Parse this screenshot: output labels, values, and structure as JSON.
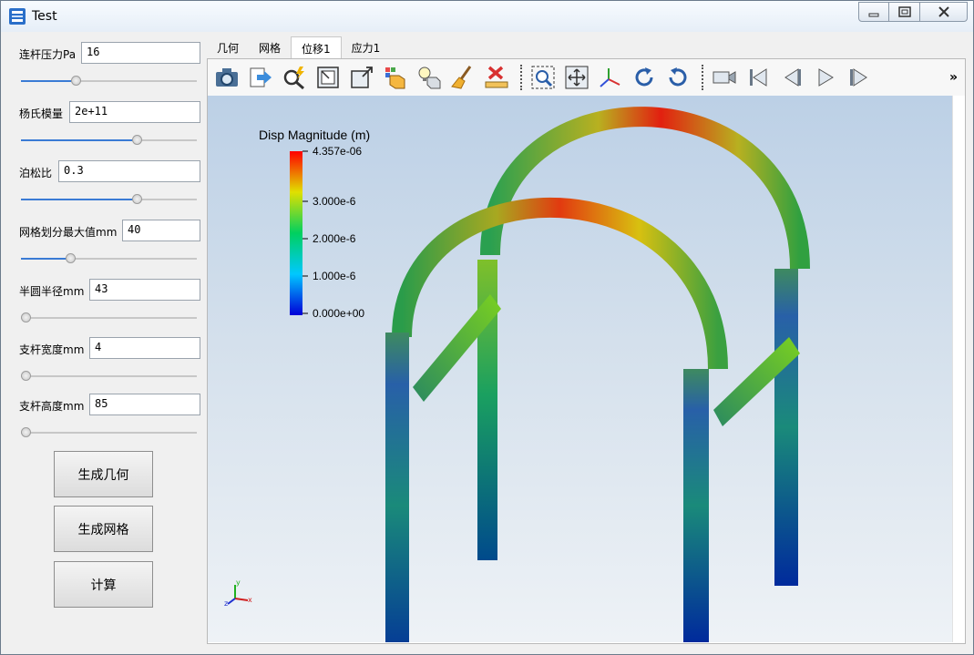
{
  "window": {
    "title": "Test"
  },
  "params": [
    {
      "label": "连杆压力Pa",
      "value": "16",
      "slider": 0.3
    },
    {
      "label": "杨氏模量",
      "value": "2e+11",
      "slider": 0.67
    },
    {
      "label": "泊松比",
      "value": "0.3",
      "slider": 0.67
    },
    {
      "label": "网格划分最大值mm",
      "value": "40",
      "slider": 0.27
    },
    {
      "label": "半圆半径mm",
      "value": "43",
      "slider": 0.0
    },
    {
      "label": "支杆宽度mm",
      "value": "4",
      "slider": 0.0
    },
    {
      "label": "支杆高度mm",
      "value": "85",
      "slider": 0.0
    }
  ],
  "buttons": {
    "geometry": "生成几何",
    "mesh": "生成网格",
    "compute": "计算"
  },
  "tabs": [
    "几何",
    "网格",
    "位移1",
    "应力1"
  ],
  "active_tab": "位移1",
  "toolbar_more": "»",
  "legend": {
    "title": "Disp Magnitude (m)",
    "ticks": [
      "4.357e-06",
      "3.000e-6",
      "2.000e-6",
      "1.000e-6",
      "0.000e+00"
    ],
    "colormap": [
      "#0000d8",
      "#00c8ff",
      "#00d060",
      "#e0e000",
      "#ff0000"
    ]
  },
  "triad": {
    "x": "x",
    "y": "y",
    "z": "z"
  },
  "colors": {
    "accent": "#3a7bd5"
  }
}
